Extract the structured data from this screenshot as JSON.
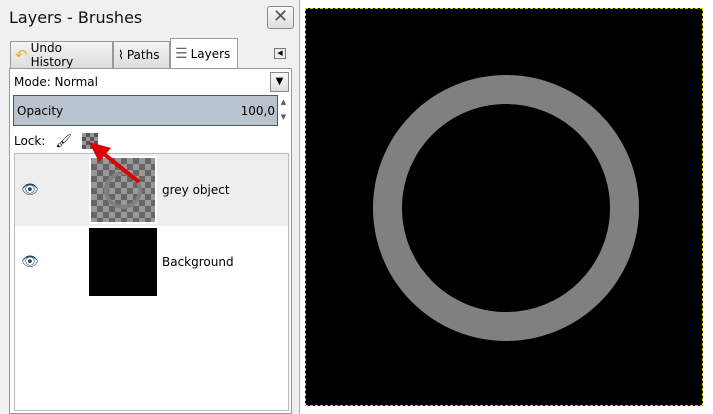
{
  "window": {
    "title": "Layers - Brushes"
  },
  "tabs": [
    {
      "label": "Undo History"
    },
    {
      "label": "Paths"
    },
    {
      "label": "Layers",
      "active": true
    }
  ],
  "mode": {
    "label": "Mode: Normal"
  },
  "opacity": {
    "label": "Opacity",
    "value": "100,0"
  },
  "lock": {
    "label": "Lock:"
  },
  "layers": [
    {
      "name": "grey object",
      "visible": true,
      "selected": true
    },
    {
      "name": "Background",
      "visible": true,
      "selected": false
    }
  ],
  "colors": {
    "ring": "#808080",
    "canvas": "#000000",
    "arrow": "#dd0000"
  }
}
